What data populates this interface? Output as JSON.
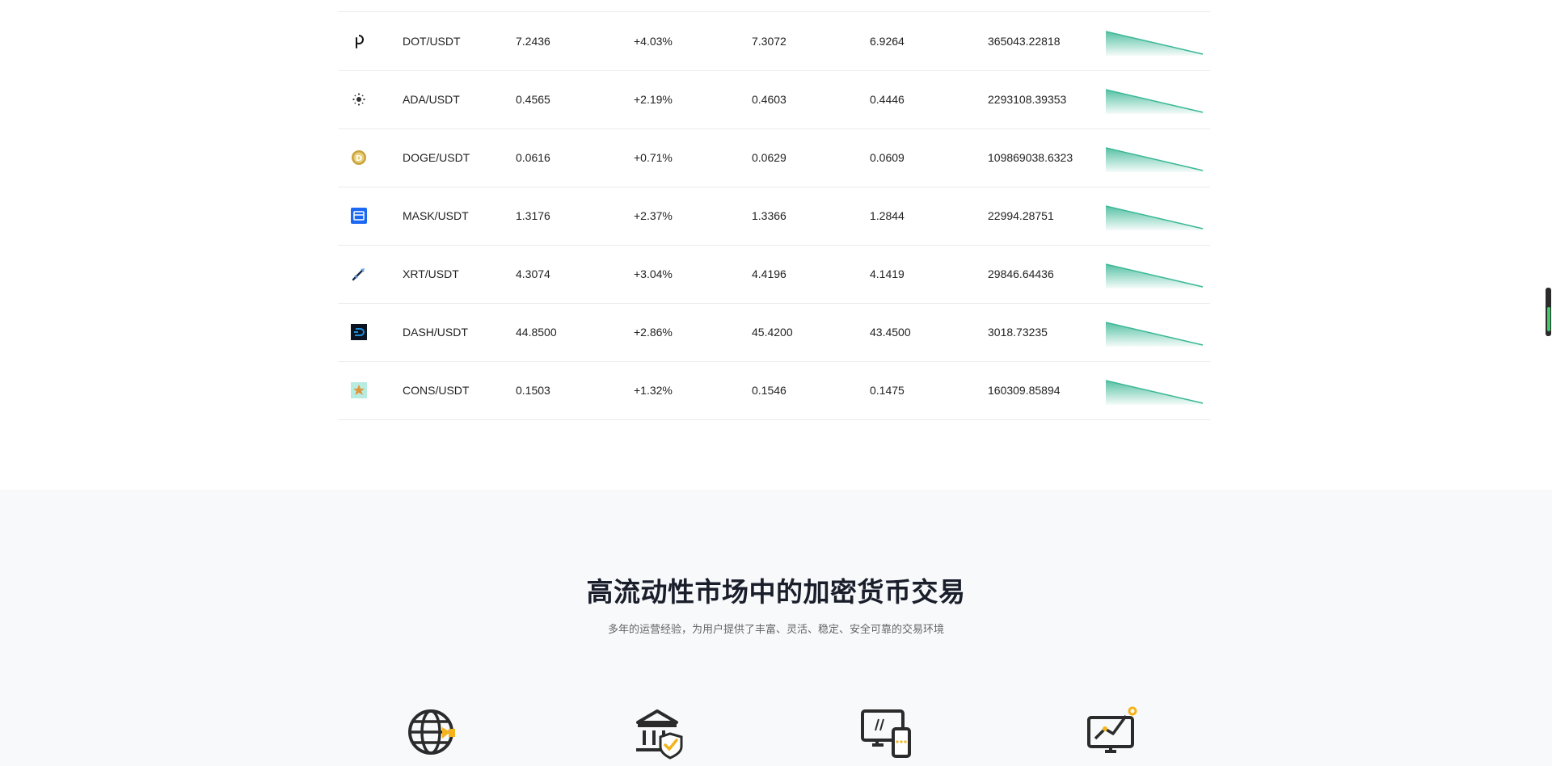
{
  "market": {
    "rows": [
      {
        "icon": "dot-coin-icon",
        "pair": "DOT/USDT",
        "price": "7.2436",
        "change": "+4.03%",
        "high": "7.3072",
        "low": "6.9264",
        "volume": "365043.22818"
      },
      {
        "icon": "ada-coin-icon",
        "pair": "ADA/USDT",
        "price": "0.4565",
        "change": "+2.19%",
        "high": "0.4603",
        "low": "0.4446",
        "volume": "2293108.39353"
      },
      {
        "icon": "doge-coin-icon",
        "pair": "DOGE/USDT",
        "price": "0.0616",
        "change": "+0.71%",
        "high": "0.0629",
        "low": "0.0609",
        "volume": "109869038.6323"
      },
      {
        "icon": "mask-coin-icon",
        "pair": "MASK/USDT",
        "price": "1.3176",
        "change": "+2.37%",
        "high": "1.3366",
        "low": "1.2844",
        "volume": "22994.28751"
      },
      {
        "icon": "xrt-coin-icon",
        "pair": "XRT/USDT",
        "price": "4.3074",
        "change": "+3.04%",
        "high": "4.4196",
        "low": "4.1419",
        "volume": "29846.64436"
      },
      {
        "icon": "dash-coin-icon",
        "pair": "DASH/USDT",
        "price": "44.8500",
        "change": "+2.86%",
        "high": "45.4200",
        "low": "43.4500",
        "volume": "3018.73235"
      },
      {
        "icon": "cons-coin-icon",
        "pair": "CONS/USDT",
        "price": "0.1503",
        "change": "+1.32%",
        "high": "0.1546",
        "low": "0.1475",
        "volume": "160309.85894"
      }
    ],
    "sparkline_color": "#3ab795"
  },
  "features": {
    "title": "高流动性市场中的加密货币交易",
    "subtitle": "多年的运营经验，为用户提供了丰富、灵活、稳定、安全可靠的交易环境",
    "icons": [
      "globe-icon",
      "bank-shield-icon",
      "devices-icon",
      "monitor-chart-icon"
    ],
    "accent": "#f5b31b"
  }
}
